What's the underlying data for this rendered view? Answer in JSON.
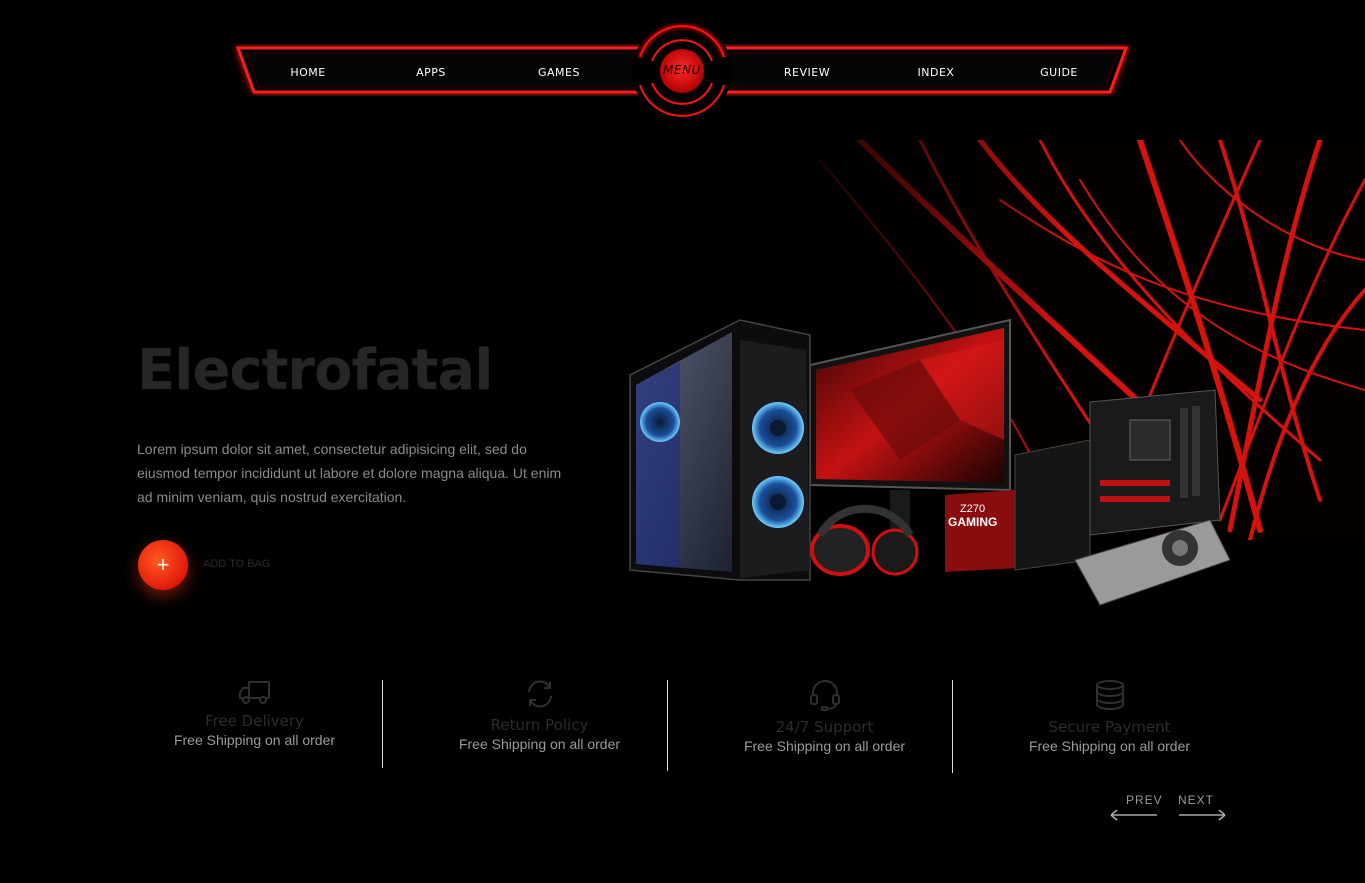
{
  "nav": {
    "items": [
      {
        "label": "HOME"
      },
      {
        "label": "APPS"
      },
      {
        "label": "GAMES"
      },
      {
        "label": "REVIEW"
      },
      {
        "label": "INDEX"
      },
      {
        "label": "GUIDE"
      }
    ],
    "menu_label": "MENU"
  },
  "hero": {
    "title": "Electrofatal",
    "description": "Lorem ipsum dolor sit amet, consectetur adipisicing elit, sed do eiusmod tempor incididunt ut labore et dolore magna aliqua. Ut enim ad minim veniam, quis nostrud exercitation.",
    "add_button_icon": "+",
    "add_label": "ADD TO BAG",
    "board_label": "Z270 GAMING"
  },
  "features": [
    {
      "icon": "truck-icon",
      "title": "Free Delivery",
      "subtitle": "Free Shipping on all order"
    },
    {
      "icon": "refresh-icon",
      "title": "Return Policy",
      "subtitle": "Free Shipping on all order"
    },
    {
      "icon": "headset-icon",
      "title": "24/7 Support",
      "subtitle": "Free Shipping on all order"
    },
    {
      "icon": "database-icon",
      "title": "Secure Payment",
      "subtitle": "Free Shipping on all order"
    }
  ],
  "pager": {
    "prev": "PREV",
    "next": "NEXT"
  },
  "colors": {
    "accent": "#e11a0c",
    "background": "#000000",
    "nav_glow": "#ff0000"
  }
}
